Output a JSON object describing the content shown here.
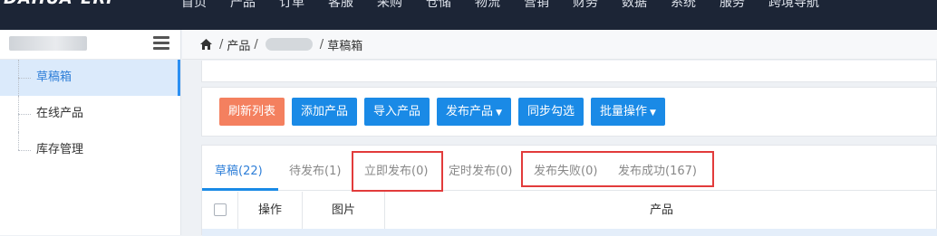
{
  "topbar": {
    "logo": "DAHUA-ERP",
    "nav": [
      "首页",
      "产品",
      "订单",
      "客服",
      "采购",
      "仓储",
      "物流",
      "营销",
      "财务",
      "数据",
      "系统",
      "服务",
      "跨境导航"
    ]
  },
  "sidebar": {
    "items": [
      {
        "label": "草稿箱",
        "active": true
      },
      {
        "label": "在线产品",
        "active": false
      },
      {
        "label": "库存管理",
        "active": false
      }
    ]
  },
  "breadcrumb": {
    "level1": "产品",
    "level3": "草稿箱"
  },
  "toolbar": {
    "refresh": "刷新列表",
    "add": "添加产品",
    "import": "导入产品",
    "publish": "发布产品",
    "sync": "同步勾选",
    "batch": "批量操作"
  },
  "tabs": [
    {
      "label": "草稿(22)",
      "active": true
    },
    {
      "label": "待发布(1)"
    },
    {
      "label": "立即发布(0)"
    },
    {
      "label": "定时发布(0)"
    },
    {
      "label": "发布失败(0)"
    },
    {
      "label": "发布成功(167)"
    }
  ],
  "table": {
    "headers": [
      "操作",
      "图片",
      "产品"
    ]
  },
  "colors": {
    "topbar": "#1c2536",
    "accent": "#1a8ae6",
    "refresh_button": "#f4805f",
    "highlight_box": "#e23b3b"
  }
}
